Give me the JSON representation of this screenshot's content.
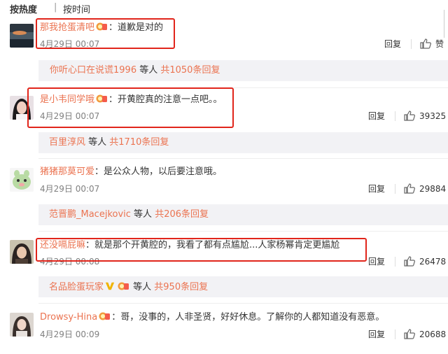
{
  "sort": {
    "hot": "按热度",
    "separator": "|",
    "time": "按时间"
  },
  "comments": [
    {
      "user": "那我抢蛋清吧",
      "text": "道歉是对的",
      "date": "4月29日 00:07",
      "reply": "回复",
      "likes": "赞",
      "sub": {
        "user": "你听心口在说谎1996",
        "mid": " 等人 ",
        "count": "共1050条回复"
      }
    },
    {
      "user": "是小韦同学哦",
      "text": "开黄腔真的注意一点吧。。",
      "date": "4月29日 00:07",
      "reply": "回复",
      "likes": "39325",
      "sub": {
        "user": "百里淳风",
        "mid": " 等人 ",
        "count": "共1710条回复"
      }
    },
    {
      "user": "猪猪那莫可爱",
      "text": "是公众人物，以后要注意哦。",
      "date": "4月29日 00:07",
      "reply": "回复",
      "likes": "29884",
      "sub": {
        "user": "范晋鹏_Macejkovic",
        "mid": " 等人 ",
        "count": "共206条回复"
      }
    },
    {
      "user": "还没嗝屁嘛",
      "text": "就是那个开黄腔的，我看了都有点尴尬...人家杨幂肯定更尴尬",
      "date": "4月29日 00:08",
      "reply": "回复",
      "likes": "26478",
      "sub": {
        "user": "名品脸蛋玩家",
        "mid": " 等人 ",
        "count": "共950条回复"
      }
    },
    {
      "user": "Drowsy-Hina",
      "text": "哥，没事的，人非圣贤，好好休息。了解你的人都知道没有恶意。",
      "date": "4月29日 00:09",
      "reply": "回复",
      "likes": "20688"
    }
  ],
  "colors": {
    "username": "#eb7350",
    "highlight_box": "#e1251b",
    "subreply_bg": "#f2f2f5"
  },
  "icons": [
    "vip-badge-icon",
    "thumbs-up-icon",
    "gold-v-icon"
  ]
}
